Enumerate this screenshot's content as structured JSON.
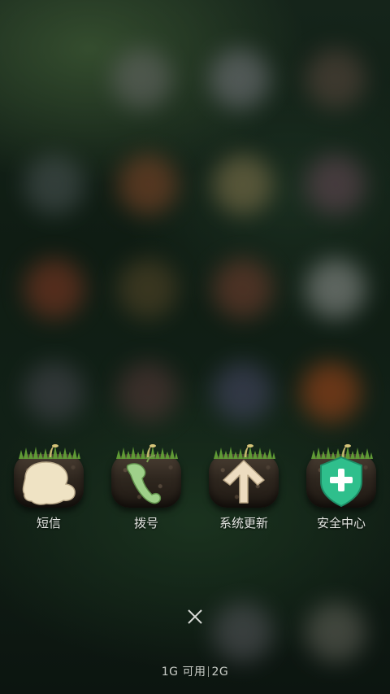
{
  "recent_apps": [
    {
      "id": "sms",
      "label": "短信",
      "icon": "speech-bubble-icon",
      "accent": "#efe3c4"
    },
    {
      "id": "dialer",
      "label": "拨号",
      "icon": "phone-sprout-icon",
      "accent": "#9fd08a"
    },
    {
      "id": "update",
      "label": "系统更新",
      "icon": "up-arrow-icon",
      "accent": "#eddcc0"
    },
    {
      "id": "security",
      "label": "安全中心",
      "icon": "shield-plus-icon",
      "accent": "#2fbf8c"
    }
  ],
  "close_label": "×",
  "memory": {
    "available": "1G 可用",
    "total": "2G"
  },
  "colors": {
    "label_text": "#e4e6e2",
    "background": "#0e1a12"
  }
}
